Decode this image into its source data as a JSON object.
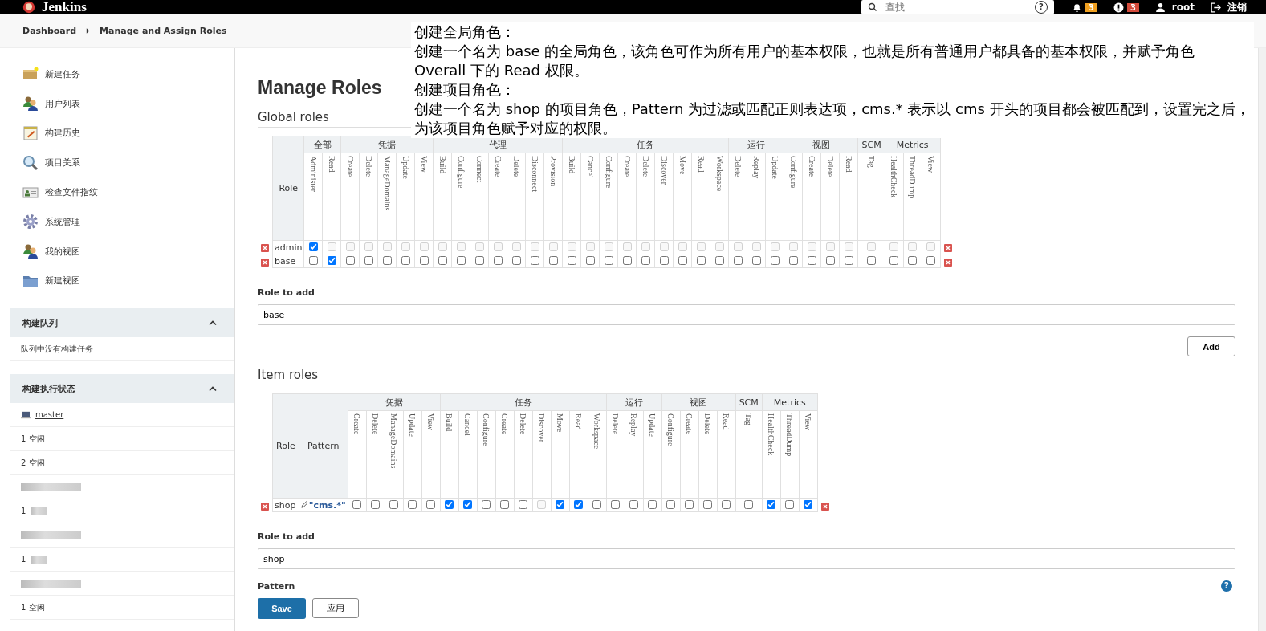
{
  "header": {
    "brand": "Jenkins",
    "search": {
      "placeholder": "查找"
    },
    "help": "?",
    "notifications": "3",
    "warnings": "3",
    "user": "root",
    "logout": "注销"
  },
  "breadcrumbs": [
    "Dashboard",
    "Manage and Assign Roles"
  ],
  "sidebar": {
    "tasks": [
      "新建任务",
      "用户列表",
      "构建历史",
      "项目关系",
      "检查文件指纹",
      "系统管理",
      "我的视图",
      "新建视图"
    ],
    "queue": {
      "title": "构建队列",
      "expanded": true,
      "empty_text": "队列中没有构建任务"
    },
    "executors": {
      "title": "构建执行状态",
      "expanded": true,
      "items": [
        {
          "kind": "node",
          "text": "master"
        },
        {
          "kind": "executor",
          "text": "1  空闲"
        },
        {
          "kind": "executor",
          "text": "2  空闲"
        },
        {
          "kind": "redacted-node"
        },
        {
          "kind": "redacted-executor",
          "text": "1"
        },
        {
          "kind": "redacted-node"
        },
        {
          "kind": "redacted-executor",
          "text": "1"
        },
        {
          "kind": "redacted-node"
        },
        {
          "kind": "executor",
          "text": "1  空闲"
        }
      ]
    }
  },
  "annotation": [
    "创建全局角色：",
    "创建一个名为 base 的全局角色，该角色可作为所有用户的基本权限，也就是所有普通用户都具备的基本权限，并赋予角色 Overall 下的 Read 权限。",
    "创建项目角色：",
    "创建一个名为 shop 的项目角色，Pattern 为过滤或匹配正则表达项，cms.* 表示以 cms 开头的项目都会被匹配到，设置完之后，为该项目角色赋予对应的权限。"
  ],
  "page_title": "Manage Roles",
  "global_roles": {
    "title": "Global roles",
    "role_header": "Role",
    "groups": [
      {
        "name": "全部",
        "permissions": [
          "Administer",
          "Read"
        ]
      },
      {
        "name": "凭据",
        "permissions": [
          "Create",
          "Delete",
          "ManageDomains",
          "Update",
          "View"
        ]
      },
      {
        "name": "代理",
        "permissions": [
          "Build",
          "Configure",
          "Connect",
          "Create",
          "Delete",
          "Disconnect",
          "Provision"
        ]
      },
      {
        "name": "任务",
        "permissions": [
          "Build",
          "Cancel",
          "Configure",
          "Create",
          "Delete",
          "Discover",
          "Move",
          "Read",
          "Workspace"
        ]
      },
      {
        "name": "运行",
        "permissions": [
          "Delete",
          "Replay",
          "Update"
        ]
      },
      {
        "name": "视图",
        "permissions": [
          "Configure",
          "Create",
          "Delete",
          "Read"
        ]
      },
      {
        "name": "SCM",
        "permissions": [
          "Tag"
        ]
      },
      {
        "name": "Metrics",
        "permissions": [
          "HealthCheck",
          "ThreadDump",
          "View"
        ]
      }
    ],
    "rows": [
      {
        "name": "admin",
        "checked": [
          true,
          false,
          false,
          false,
          false,
          false,
          false,
          false,
          false,
          false,
          false,
          false,
          false,
          false,
          false,
          false,
          false,
          false,
          false,
          false,
          false,
          false,
          false,
          false,
          false,
          false,
          false,
          false,
          false,
          false,
          false,
          false,
          false,
          false
        ],
        "disabled": [
          false,
          true,
          true,
          true,
          true,
          true,
          true,
          true,
          true,
          true,
          true,
          true,
          true,
          true,
          true,
          true,
          true,
          true,
          true,
          true,
          true,
          true,
          true,
          true,
          true,
          true,
          true,
          true,
          true,
          true,
          true,
          true,
          true,
          true
        ]
      },
      {
        "name": "base",
        "checked": [
          false,
          true,
          false,
          false,
          false,
          false,
          false,
          false,
          false,
          false,
          false,
          false,
          false,
          false,
          false,
          false,
          false,
          false,
          false,
          false,
          false,
          false,
          false,
          false,
          false,
          false,
          false,
          false,
          false,
          false,
          false,
          false,
          false,
          false
        ],
        "disabled": [
          false,
          false,
          false,
          false,
          false,
          false,
          false,
          false,
          false,
          false,
          false,
          false,
          false,
          false,
          false,
          false,
          false,
          false,
          false,
          false,
          false,
          false,
          false,
          false,
          false,
          false,
          false,
          false,
          false,
          false,
          false,
          false,
          false,
          false
        ]
      }
    ],
    "add_label": "Role to add",
    "add_value": "base",
    "add_button": "Add"
  },
  "item_roles": {
    "title": "Item roles",
    "role_header": "Role",
    "pattern_header": "Pattern",
    "groups": [
      {
        "name": "凭据",
        "permissions": [
          "Create",
          "Delete",
          "ManageDomains",
          "Update",
          "View"
        ]
      },
      {
        "name": "任务",
        "permissions": [
          "Build",
          "Cancel",
          "Configure",
          "Create",
          "Delete",
          "Discover",
          "Move",
          "Read",
          "Workspace"
        ]
      },
      {
        "name": "运行",
        "permissions": [
          "Delete",
          "Replay",
          "Update"
        ]
      },
      {
        "name": "视图",
        "permissions": [
          "Configure",
          "Create",
          "Delete",
          "Read"
        ]
      },
      {
        "name": "SCM",
        "permissions": [
          "Tag"
        ]
      },
      {
        "name": "Metrics",
        "permissions": [
          "HealthCheck",
          "ThreadDump",
          "View"
        ]
      }
    ],
    "rows": [
      {
        "name": "shop",
        "pattern": "\"cms.*\"",
        "checked": [
          false,
          false,
          false,
          false,
          false,
          true,
          true,
          false,
          false,
          false,
          false,
          true,
          true,
          false,
          false,
          false,
          false,
          false,
          false,
          false,
          false,
          false,
          true,
          false,
          true
        ],
        "disabled": [
          false,
          false,
          false,
          false,
          false,
          false,
          false,
          false,
          false,
          false,
          true,
          false,
          false,
          false,
          false,
          false,
          false,
          false,
          false,
          false,
          false,
          false,
          false,
          false,
          false
        ]
      }
    ],
    "add_label": "Role to add",
    "add_value": "shop",
    "pattern_label": "Pattern",
    "help": "?"
  },
  "buttons": {
    "save": "Save",
    "apply": "应用"
  }
}
